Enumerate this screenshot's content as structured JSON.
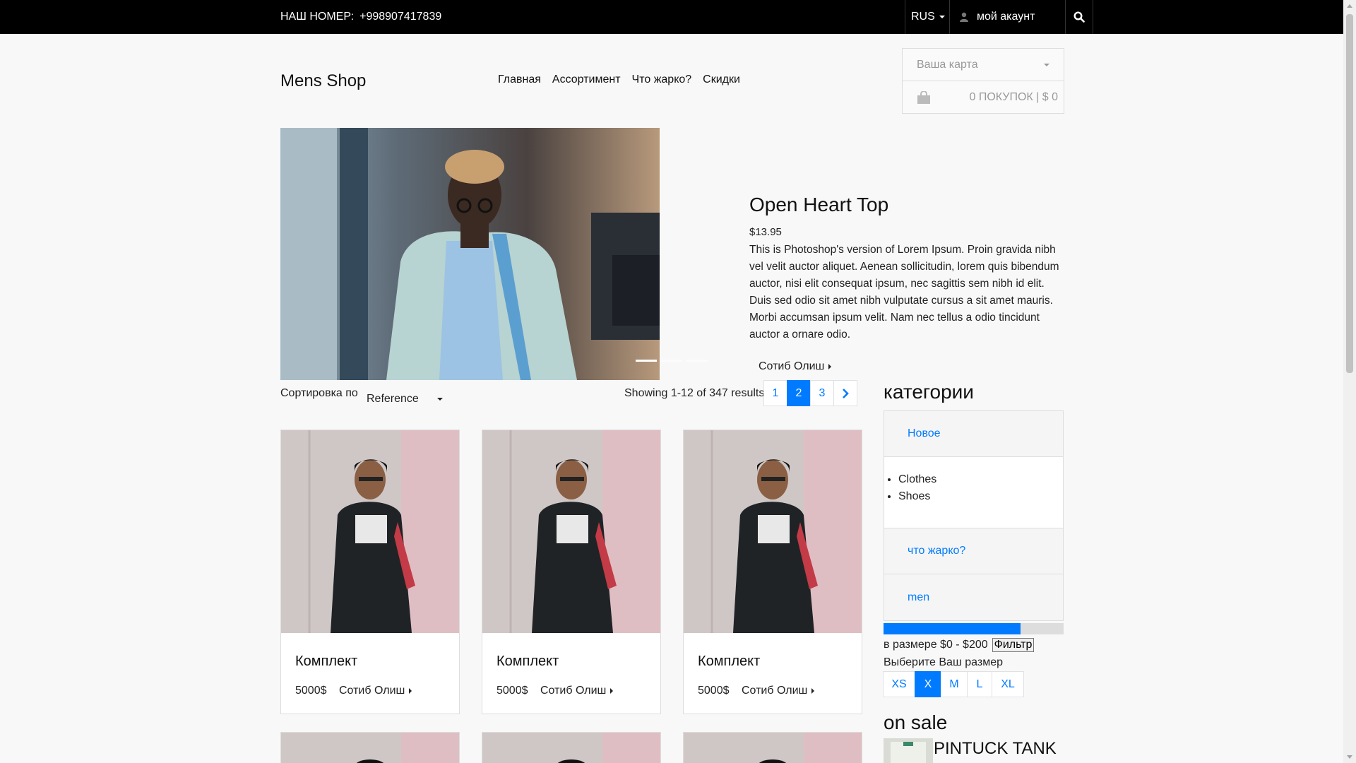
{
  "topbar": {
    "phone_label": "НАШ НОМЕР:",
    "phone_number": "+998907417839",
    "language": "RUS",
    "account_label": "мой акаунт",
    "search_icon": "search-icon"
  },
  "header": {
    "brand": "Mens Shop",
    "nav": [
      "Главная",
      "Ассортимент",
      "Что жарко?",
      "Скидки"
    ],
    "cart": {
      "placeholder": "Ваша карта",
      "summary": "0 ПОКУПОК | $ 0",
      "icon": "shopping-bag-icon"
    }
  },
  "hero": {
    "title": "Open Heart Top",
    "price": "$13.95",
    "description": "This is Photoshop's version of Lorem Ipsum. Proin gravida nibh vel velit auctor aliquet. Aenean sollicitudin, lorem quis bibendum auctor, nisi elit consequat ipsum, nec sagittis sem nibh id elit. Duis sed odio sit amet nibh vulputate cursus a sit amet mauris. Morbi accumsan ipsum velit. Nam nec tellus a odio tincidunt auctor a ornare odio.",
    "buy_label": "Сотиб Олиш"
  },
  "toolbar": {
    "sort_label": "Сортировка по",
    "sort_value": "Reference",
    "results_text": "Showing 1-12 of 347 results",
    "pages": [
      "1",
      "2",
      "3"
    ],
    "active_page": "2",
    "next_icon": "chevron-right-icon"
  },
  "products": [
    {
      "name": "Комплект",
      "price": "5000$",
      "buy_label": "Сотиб Олиш"
    },
    {
      "name": "Комплект",
      "price": "5000$",
      "buy_label": "Сотиб Олиш"
    },
    {
      "name": "Комплект",
      "price": "5000$",
      "buy_label": "Сотиб Олиш"
    }
  ],
  "sidebar": {
    "categories_title": "категории",
    "categories": {
      "new": "Новое",
      "sub_items": [
        "Clothes",
        "Shoes"
      ],
      "hot": "что жарко?",
      "men": "men"
    },
    "price_range_text": "в размере $0 - $200",
    "price_range_fill": 0.76,
    "filter_button": "Фильтр",
    "size_label": "Выберите Ваш размер",
    "sizes": [
      "XS",
      "X",
      "M",
      "L",
      "XL"
    ],
    "active_size": "X",
    "on_sale_title": "on sale",
    "on_sale_item": "PINTUCK TANK"
  },
  "colors": {
    "accent": "#007bff",
    "topbar_bg": "#000000",
    "page_bg": "#f8f8f8"
  }
}
